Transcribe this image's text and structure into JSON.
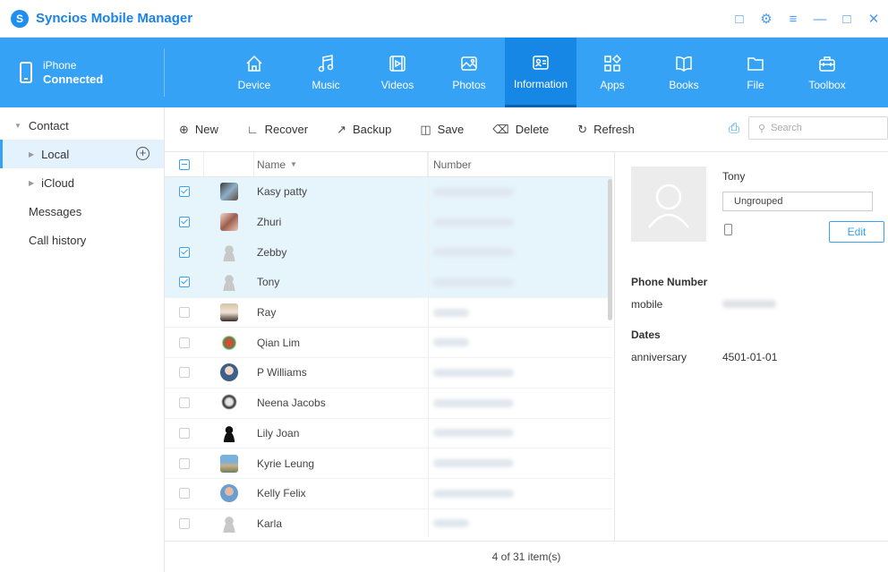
{
  "app": {
    "title": "Syncios Mobile Manager"
  },
  "device": {
    "line1": "iPhone",
    "line2": "Connected"
  },
  "nav": [
    {
      "label": "Device",
      "icon": "home-icon"
    },
    {
      "label": "Music",
      "icon": "music-icon"
    },
    {
      "label": "Videos",
      "icon": "video-icon"
    },
    {
      "label": "Photos",
      "icon": "photo-icon"
    },
    {
      "label": "Information",
      "icon": "contact-card-icon",
      "active": true
    },
    {
      "label": "Apps",
      "icon": "apps-icon"
    },
    {
      "label": "Books",
      "icon": "book-icon"
    },
    {
      "label": "File",
      "icon": "folder-icon"
    },
    {
      "label": "Toolbox",
      "icon": "toolbox-icon"
    }
  ],
  "sidebar": {
    "contact": "Contact",
    "local": "Local",
    "icloud": "iCloud",
    "messages": "Messages",
    "call_history": "Call history"
  },
  "toolbar": {
    "new": "New",
    "recover": "Recover",
    "backup": "Backup",
    "save": "Save",
    "delete": "Delete",
    "refresh": "Refresh",
    "search_placeholder": "Search"
  },
  "table": {
    "headers": {
      "name": "Name",
      "number": "Number"
    },
    "rows": [
      {
        "name": "Kasy patty",
        "checked": true
      },
      {
        "name": "Zhuri",
        "checked": true
      },
      {
        "name": "Zebby",
        "checked": true
      },
      {
        "name": "Tony",
        "checked": true
      },
      {
        "name": "Ray",
        "checked": false
      },
      {
        "name": "Qian Lim",
        "checked": false
      },
      {
        "name": "P Williams",
        "checked": false
      },
      {
        "name": "Neena Jacobs",
        "checked": false
      },
      {
        "name": "Lily Joan",
        "checked": false
      },
      {
        "name": "Kyrie Leung",
        "checked": false
      },
      {
        "name": "Kelly Felix",
        "checked": false
      },
      {
        "name": "Karla",
        "checked": false
      }
    ]
  },
  "footer": {
    "status": "4 of 31 item(s)"
  },
  "detail": {
    "name": "Tony",
    "group": "Ungrouped",
    "edit": "Edit",
    "phone_heading": "Phone Number",
    "phone_label": "mobile",
    "dates_heading": "Dates",
    "date_label": "anniversary",
    "date_value": "4501-01-01"
  },
  "colors": {
    "accent": "#36a2f5",
    "nav_active": "#1787e5",
    "selected_row": "#e6f4fc"
  }
}
